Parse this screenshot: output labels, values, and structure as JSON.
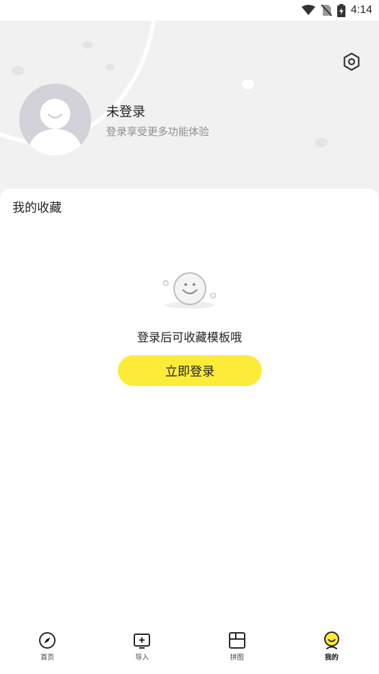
{
  "status_bar": {
    "time": "4:14"
  },
  "profile": {
    "name": "未登录",
    "subtitle": "登录享受更多功能体验"
  },
  "favorites": {
    "title": "我的收藏",
    "empty_text": "登录后可收藏模板哦",
    "login_button": "立即登录"
  },
  "bottom_nav": {
    "items": [
      {
        "label": "首页",
        "icon": "compass-icon"
      },
      {
        "label": "导入",
        "icon": "import-add-icon"
      },
      {
        "label": "拼图",
        "icon": "collage-icon"
      },
      {
        "label": "我的",
        "icon": "profile-face-icon",
        "active": true
      }
    ]
  },
  "colors": {
    "accent": "#fdeb3a",
    "header_bg": "#f1f1f2",
    "avatar_bg": "#d2d2d8"
  }
}
